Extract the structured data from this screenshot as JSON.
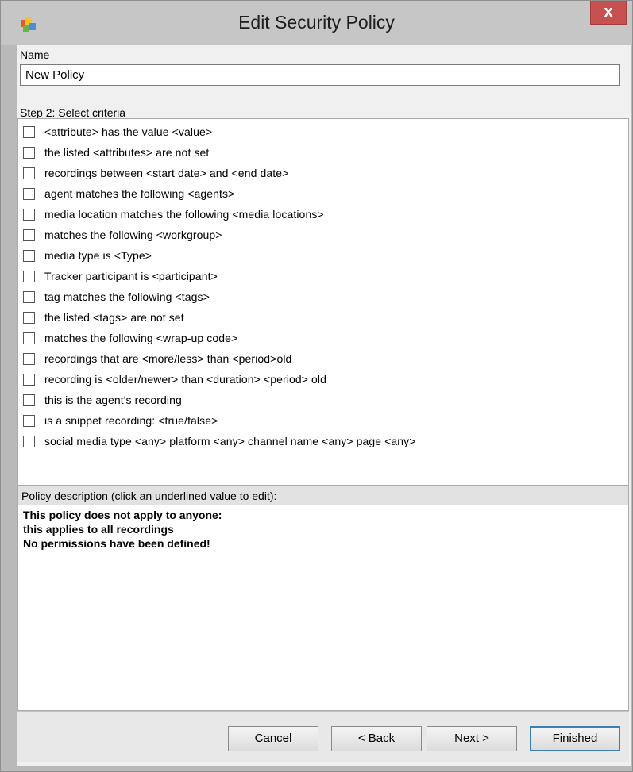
{
  "window": {
    "title": "Edit Security Policy",
    "close_label": "x",
    "app_icon": "policy-app-icon"
  },
  "name_section": {
    "label": "Name",
    "value": "New Policy"
  },
  "criteria_section": {
    "label": "Step 2: Select criteria",
    "items": [
      {
        "label": "<attribute> has the value <value>",
        "checked": false
      },
      {
        "label": "the listed <attributes> are not set",
        "checked": false
      },
      {
        "label": "recordings between <start date> and <end date>",
        "checked": false
      },
      {
        "label": "agent matches the following <agents>",
        "checked": false
      },
      {
        "label": "media location matches the following <media locations>",
        "checked": false
      },
      {
        "label": "matches the following <workgroup>",
        "checked": false
      },
      {
        "label": "media type is <Type>",
        "checked": false
      },
      {
        "label": "Tracker participant is <participant>",
        "checked": false
      },
      {
        "label": "tag matches the following <tags>",
        "checked": false
      },
      {
        "label": "the listed <tags> are not set",
        "checked": false
      },
      {
        "label": "matches the following <wrap-up code>",
        "checked": false
      },
      {
        "label": "recordings that are <more/less> than <period>old",
        "checked": false
      },
      {
        "label": "recording is <older/newer> than <duration> <period> old",
        "checked": false
      },
      {
        "label": "this is the agent's recording",
        "checked": false
      },
      {
        "label": "is a snippet recording: <true/false>",
        "checked": false
      },
      {
        "label": "social media type <any> platform <any> channel name <any> page <any>",
        "checked": false
      }
    ]
  },
  "description_section": {
    "header": "Policy description (click an underlined value to edit):",
    "lines": [
      "This policy does not apply to anyone:",
      "this applies to all recordings",
      "No permissions have been defined!"
    ]
  },
  "buttons": {
    "cancel": "Cancel",
    "back": "< Back",
    "next": "Next >",
    "finished": "Finished"
  }
}
